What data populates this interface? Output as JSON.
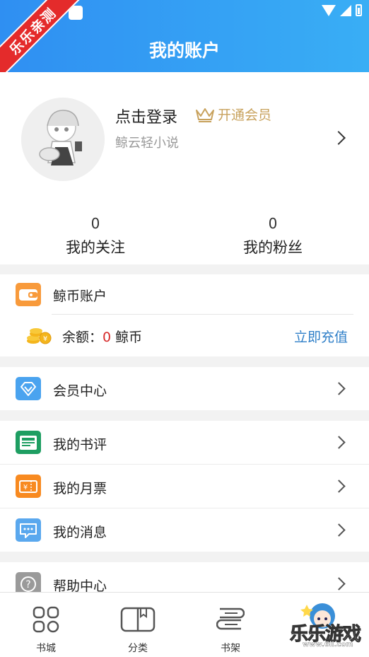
{
  "header": {
    "title": "我的账户",
    "badge": "乐乐亲测"
  },
  "profile": {
    "login_text": "点击登录",
    "vip_label": "开通会员",
    "subtitle": "鲸云轻小说",
    "stats": [
      {
        "count": "0",
        "label": "我的关注"
      },
      {
        "count": "0",
        "label": "我的粉丝"
      }
    ]
  },
  "wallet": {
    "title": "鲸币账户",
    "balance_label": "余额：",
    "balance_value": "0",
    "balance_unit": "鲸币",
    "recharge_label": "立即充值"
  },
  "menu": {
    "vip_center": "会员中心",
    "my_reviews": "我的书评",
    "my_monthly_tickets": "我的月票",
    "my_messages": "我的消息",
    "help_center": "帮助中心"
  },
  "tabbar": {
    "tabs": [
      {
        "label": "书城",
        "icon": "grid-icon"
      },
      {
        "label": "分类",
        "icon": "book-open-icon"
      },
      {
        "label": "书架",
        "icon": "bookshelf-icon"
      }
    ]
  },
  "watermark": {
    "text": "乐乐游戏",
    "url": "www.6ll.com"
  },
  "colors": {
    "header_start": "#2f8ff2",
    "header_end": "#39aef5",
    "vip_gold": "#c8a25d",
    "balance_red": "#d72b2b",
    "link_blue": "#2f7fc8"
  }
}
